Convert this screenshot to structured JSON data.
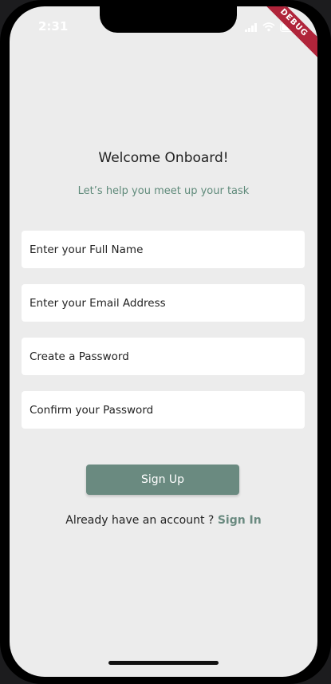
{
  "status_bar": {
    "time": "2:31",
    "debug_label": "DEBUG"
  },
  "header": {
    "title": "Welcome Onboard!",
    "subtitle": "Let’s help you meet up your task"
  },
  "form": {
    "full_name_placeholder": "Enter your Full Name",
    "email_placeholder": "Enter your Email Address",
    "password_placeholder": "Create a Password",
    "confirm_password_placeholder": "Confirm your Password",
    "submit_label": "Sign Up"
  },
  "footer": {
    "prompt": "Already have an account ?",
    "signin_label": "Sign In"
  },
  "colors": {
    "accent": "#6a8a80",
    "subtitle": "#5f8a7a",
    "background": "#ececec",
    "field": "#ffffff"
  }
}
